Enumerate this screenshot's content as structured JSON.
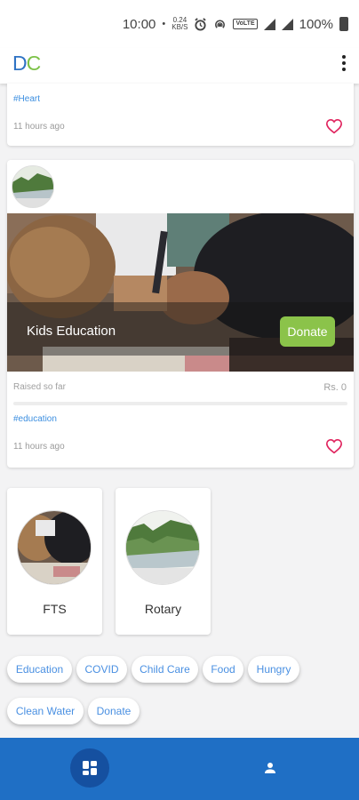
{
  "status_bar": {
    "time": "10:00",
    "dot": "•",
    "data_speed": "0.24",
    "data_unit": "KB/S",
    "volte_label": "VoLTE",
    "battery": "100%",
    "icons": [
      "alarm-icon",
      "hotspot-icon",
      "volte-icon",
      "signal-icon",
      "signal-4g-icon",
      "battery-icon"
    ]
  },
  "app_bar": {
    "logo_d": "D",
    "logo_c": "C",
    "menu_icon": "more-vert-icon"
  },
  "feed": [
    {
      "tag": "#Heart",
      "time": "11 hours ago"
    },
    {
      "title": "Kids Education",
      "donate_label": "Donate",
      "raised_label": "Raised so far",
      "raised_amount": "Rs. 0",
      "progress": 0,
      "tag": "#education",
      "time": "11 hours ago"
    }
  ],
  "organizations": [
    {
      "name": "FTS"
    },
    {
      "name": "Rotary"
    }
  ],
  "categories": [
    "Education",
    "COVID",
    "Child Care",
    "Food",
    "Hungry",
    "Clean Water",
    "Donate"
  ],
  "bottom_nav": {
    "home_icon": "dashboard-icon",
    "profile_icon": "person-icon"
  },
  "colors": {
    "brand_blue": "#2f73c4",
    "brand_green": "#7cc247",
    "donate_green": "#8bc34a",
    "heart_red": "#e0245e",
    "nav_blue": "#1f6fc5"
  }
}
